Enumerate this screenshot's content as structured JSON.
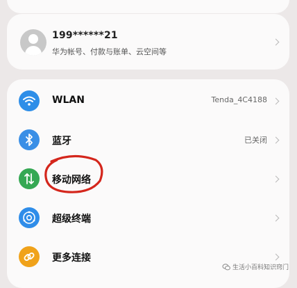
{
  "account": {
    "name": "199******21",
    "subtitle": "华为帐号、付款与账单、云空间等"
  },
  "settings_items": [
    {
      "label": "WLAN",
      "value": "Tenda_4C4188",
      "icon": "wifi-icon",
      "color": "#2e8ee8"
    },
    {
      "label": "蓝牙",
      "value": "已关闭",
      "icon": "bluetooth-icon",
      "color": "#3a8fe6"
    },
    {
      "label": "移动网络",
      "value": "",
      "icon": "mobile-network-icon",
      "color": "#35a853"
    },
    {
      "label": "超级终端",
      "value": "",
      "icon": "super-device-icon",
      "color": "#2f8de9"
    },
    {
      "label": "更多连接",
      "value": "",
      "icon": "link-icon",
      "color": "#f0a21a"
    }
  ],
  "annotation": {
    "circled_item": "移动网络",
    "color": "#d4261c"
  },
  "watermark": {
    "text": "生活小百科知识窍门"
  }
}
